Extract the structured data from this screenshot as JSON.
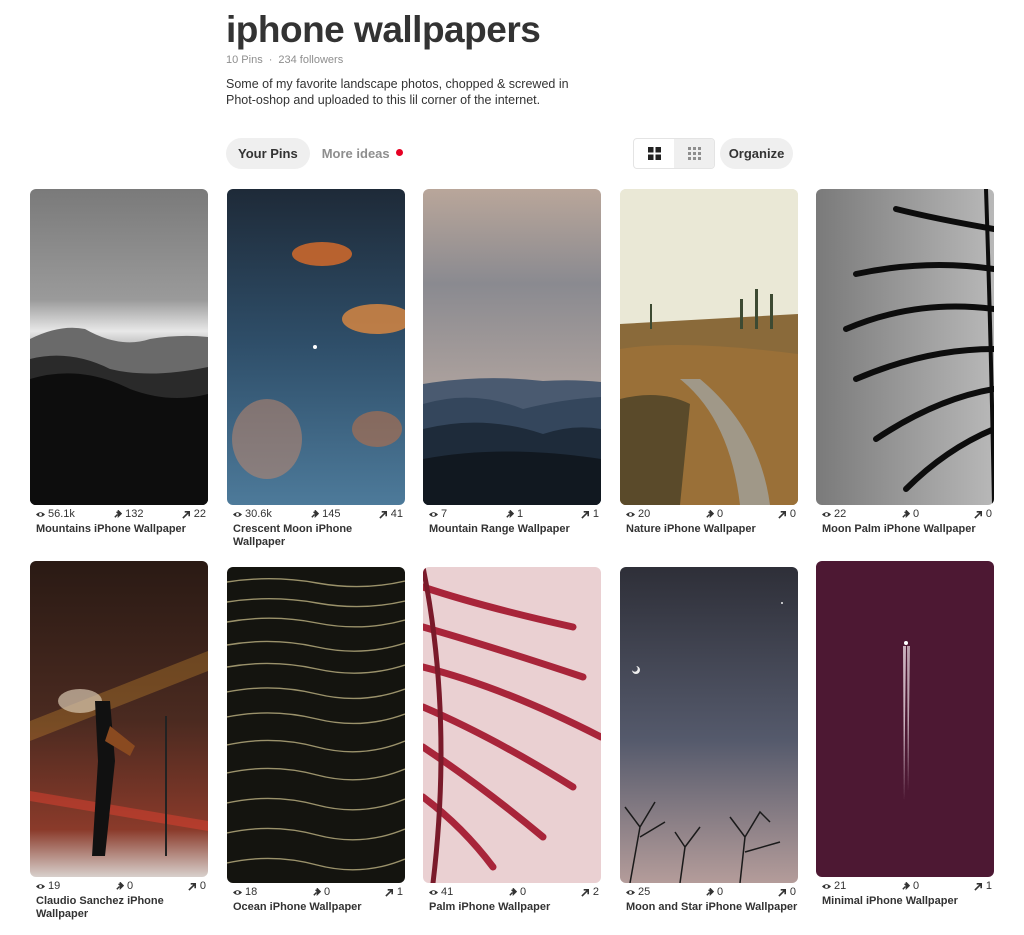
{
  "board": {
    "title": "iphone wallpapers",
    "pins_count": "10 Pins",
    "followers": "234 followers",
    "description": "Some of my favorite landscape photos, chopped & screwed in Phot-oshop and uploaded to this lil corner of the internet."
  },
  "tabs": {
    "your_pins": "Your Pins",
    "more_ideas": "More ideas"
  },
  "organize_label": "Organize",
  "pins": [
    {
      "title": "Mountains iPhone Wallpaper",
      "views": "56.1k",
      "saves": "132",
      "clicks": "22"
    },
    {
      "title": "Crescent Moon iPhone Wallpaper",
      "views": "30.6k",
      "saves": "145",
      "clicks": "41"
    },
    {
      "title": "Mountain Range Wallpaper",
      "views": "7",
      "saves": "1",
      "clicks": "1"
    },
    {
      "title": "Nature iPhone Wallpaper",
      "views": "20",
      "saves": "0",
      "clicks": "0"
    },
    {
      "title": "Moon Palm iPhone Wallpaper",
      "views": "22",
      "saves": "0",
      "clicks": "0"
    },
    {
      "title": "Claudio Sanchez iPhone Wallpaper",
      "views": "19",
      "saves": "0",
      "clicks": "0"
    },
    {
      "title": "Ocean iPhone Wallpaper",
      "views": "18",
      "saves": "0",
      "clicks": "1"
    },
    {
      "title": "Palm iPhone Wallpaper",
      "views": "41",
      "saves": "0",
      "clicks": "2"
    },
    {
      "title": "Moon and Star iPhone Wallpaper",
      "views": "25",
      "saves": "0",
      "clicks": "0"
    },
    {
      "title": "Minimal iPhone Wallpaper",
      "views": "21",
      "saves": "0",
      "clicks": "1"
    }
  ],
  "icons": {
    "views": "eye-icon",
    "saves": "pin-icon",
    "clicks": "arrow-up-right-icon",
    "grid_large": "grid-large-icon",
    "grid_small": "grid-small-icon"
  },
  "colors": {
    "notification_dot": "#e60023",
    "button_bg": "#efefef",
    "muted_text": "#8e8e8e"
  }
}
